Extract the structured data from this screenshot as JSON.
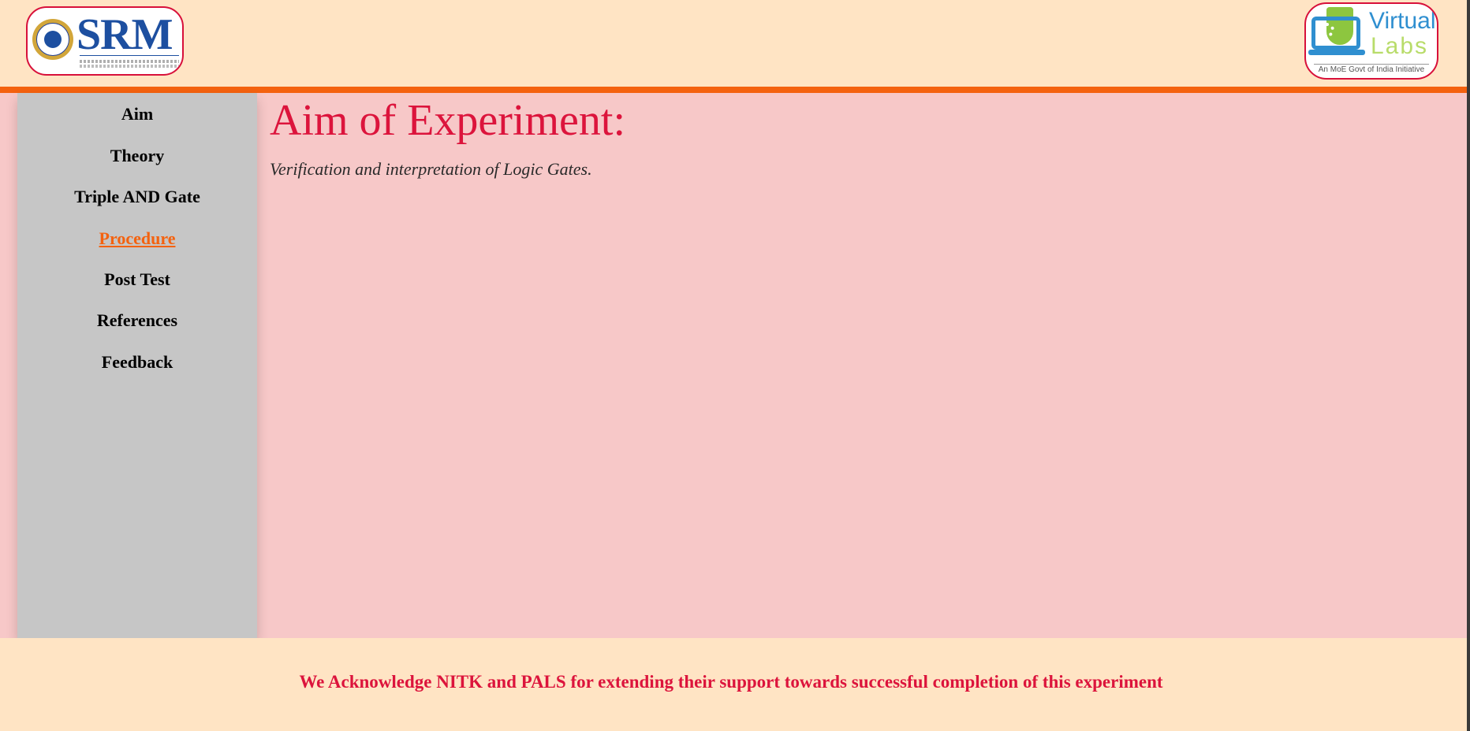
{
  "header": {
    "left_logo": {
      "name": "SRM",
      "sub": "INSTITUTE OF SCIENCE & TECHNOLOGY"
    },
    "right_logo": {
      "line1": "Virtual",
      "line2": "Labs",
      "tagline": "An MoE Govt of India Initiative"
    }
  },
  "sidebar": {
    "items": [
      {
        "label": "Aim",
        "active": false
      },
      {
        "label": "Theory",
        "active": false
      },
      {
        "label": "Triple AND Gate",
        "active": false
      },
      {
        "label": "Procedure",
        "active": true
      },
      {
        "label": "Post Test",
        "active": false
      },
      {
        "label": "References",
        "active": false
      },
      {
        "label": "Feedback",
        "active": false
      }
    ]
  },
  "main": {
    "title": "Aim of Experiment:",
    "text": "Verification and interpretation of Logic Gates."
  },
  "footer": {
    "text": "We Acknowledge NITK and PALS for extending their support towards successful completion of this experiment"
  },
  "colors": {
    "header_bg": "#ffe4c4",
    "accent_bar": "#f4620f",
    "content_bg": "#f7c8c8",
    "sidebar_bg": "#c6c6c6",
    "title_color": "#dc143c",
    "active_link": "#f4620f"
  }
}
